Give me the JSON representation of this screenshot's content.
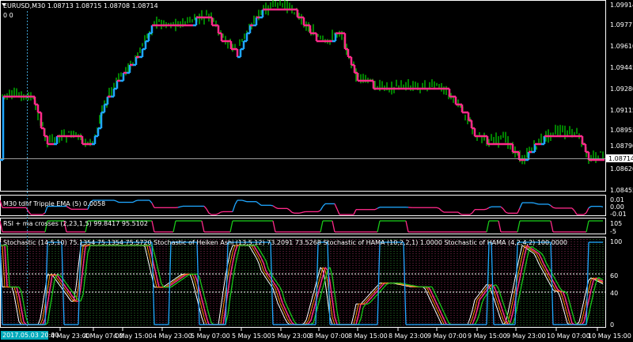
{
  "main": {
    "title": "EURUSD,M30  1.08713 1.08715 1.08708 1.08714",
    "corner": "0  0",
    "price_ticks": [
      "1.09914",
      "1.09771",
      "1.09610",
      "1.09445",
      "1.09280",
      "1.09115",
      "1.08955",
      "1.08790",
      "1.08620",
      "1.08455"
    ],
    "current_price": "1.08714",
    "colors": {
      "candle": "#00ff00",
      "ma_up": "#1fa7ff",
      "ma_down": "#ff2a8a",
      "grid": "#ffffff"
    }
  },
  "panels": [
    {
      "label": "M30 tdhf Tripple EMA (5) 0.0058",
      "ticks": [
        "0.01",
        "0.00",
        "-0.01"
      ]
    },
    {
      "label": "RSI + ma crosses (2,23,1,5) 99.8417 95.5102",
      "ticks": [
        "105",
        "-5"
      ]
    },
    {
      "label": "Stochastic (14,5,10) 75.1354 75.1354 75.5720  Stochastic of Heiken Ashi (13,5,12) 73.2091 73.5268  Stochastic of HAMA (10,2,2,1) 1.0000  Stochastic of HAMA (4,2,4,2) 100.0000",
      "ticks": [
        "100",
        "60",
        "40",
        "0"
      ]
    }
  ],
  "time_axis": {
    "highlight": "2017.05.03 20:00",
    "labels": [
      "4 May 23:00",
      "4 May 07:00",
      "4 May 15:00",
      "4 May 23:00",
      "5 May 07:00",
      "5 May 15:00",
      "5 May 23:00",
      "8 May 07:00",
      "8 May 15:00",
      "8 May 23:00",
      "9 May 07:00",
      "9 May 15:00",
      "9 May 23:00",
      "10 May 07:00",
      "10 May 15:00"
    ]
  }
}
